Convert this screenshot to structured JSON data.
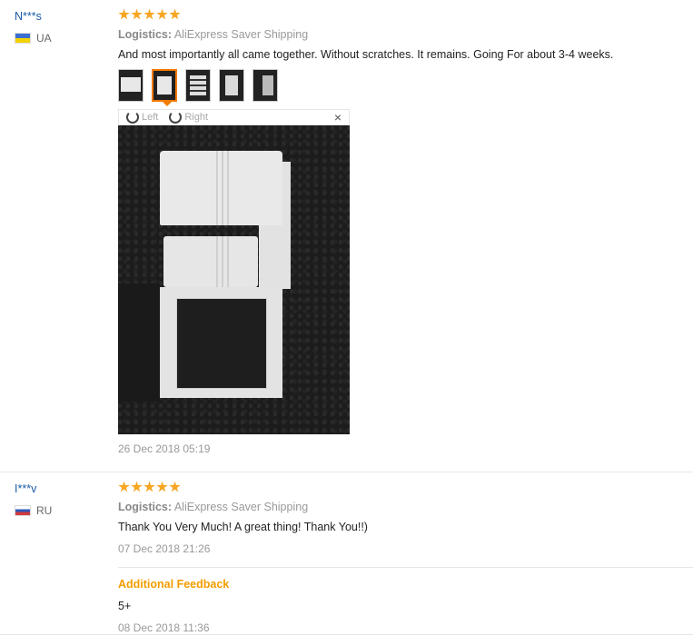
{
  "reviews": [
    {
      "user": "N***s",
      "country": "UA",
      "stars": 5,
      "logistics_label": "Logistics:",
      "logistics_value": "AliExpress Saver Shipping",
      "text": "And most importantly all came together. Without scratches. It remains. Going For about 3-4 weeks.",
      "viewer": {
        "left_label": "Left",
        "right_label": "Right",
        "close": "×"
      },
      "date": "26 Dec 2018 05:19"
    },
    {
      "user": "I***v",
      "country": "RU",
      "stars": 5,
      "logistics_label": "Logistics:",
      "logistics_value": "AliExpress Saver Shipping",
      "text": "Thank You Very Much! A great thing! Thank You!!)",
      "date": "07 Dec 2018 21:26",
      "additional_feedback": {
        "title": "Additional Feedback",
        "text": "5+",
        "date": "08 Dec 2018 11:36"
      }
    }
  ],
  "colors": {
    "accent": "#f39c00",
    "star": "#f6a623",
    "username": "#1a5aa8"
  },
  "icons": [
    "star-icon",
    "rotate-left-icon",
    "rotate-right-icon",
    "close-icon",
    "flag-ua-icon",
    "flag-ru-icon"
  ]
}
